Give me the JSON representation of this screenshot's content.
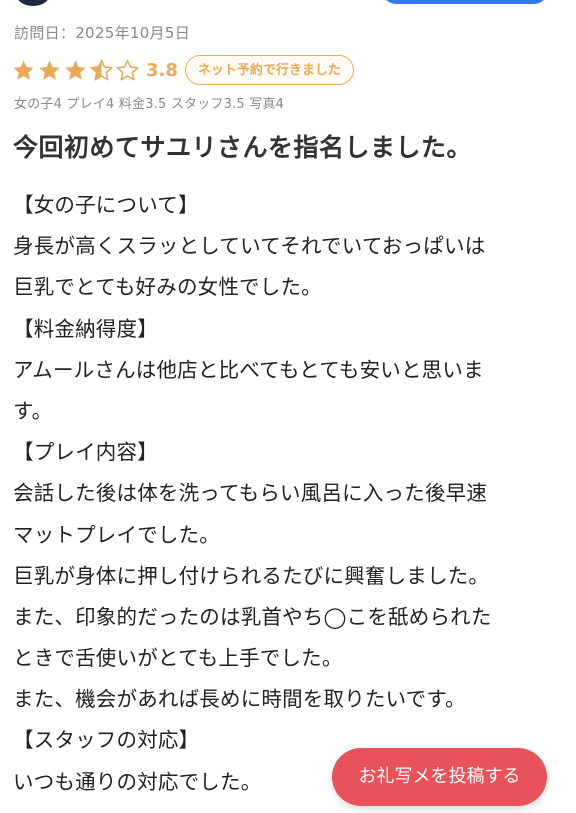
{
  "colors": {
    "accent_orange": "#e8a95a",
    "button_red": "#e8525a",
    "meta_gray": "#888888",
    "top_button_blue": "#2f7be5"
  },
  "review": {
    "visit_date": "訪問日：2025年10月5日",
    "rating": {
      "stars_value": 3.5,
      "stars_max": 5,
      "score_text": "3.8"
    },
    "badge": "ネット予約で行きました",
    "scores_line": "女の子4 プレイ4 料金3.5 スタッフ3.5 写真4",
    "title": "今回初めてサユリさんを指名しました。",
    "body_lines": [
      "【女の子について】",
      "身長が高くスラッとしていてそれでいておっぱいは",
      "巨乳でとても好みの女性でした。",
      "【料金納得度】",
      "アムールさんは他店と比べてもとても安いと思いま",
      "す。",
      "【プレイ内容】",
      "会話した後は体を洗ってもらい風呂に入った後早速",
      "マットプレイでした。",
      "巨乳が身体に押し付けられるたびに興奮しました。",
      "また、印象的だったのは乳首やち◯こを舐められた",
      "ときで舌使いがとても上手でした。",
      "また、機会があれば長めに時間を取りたいです。",
      "【スタッフの対応】",
      "いつも通りの対応でした。"
    ]
  },
  "post_photo_button": {
    "label": "お礼写メを投稿する"
  }
}
